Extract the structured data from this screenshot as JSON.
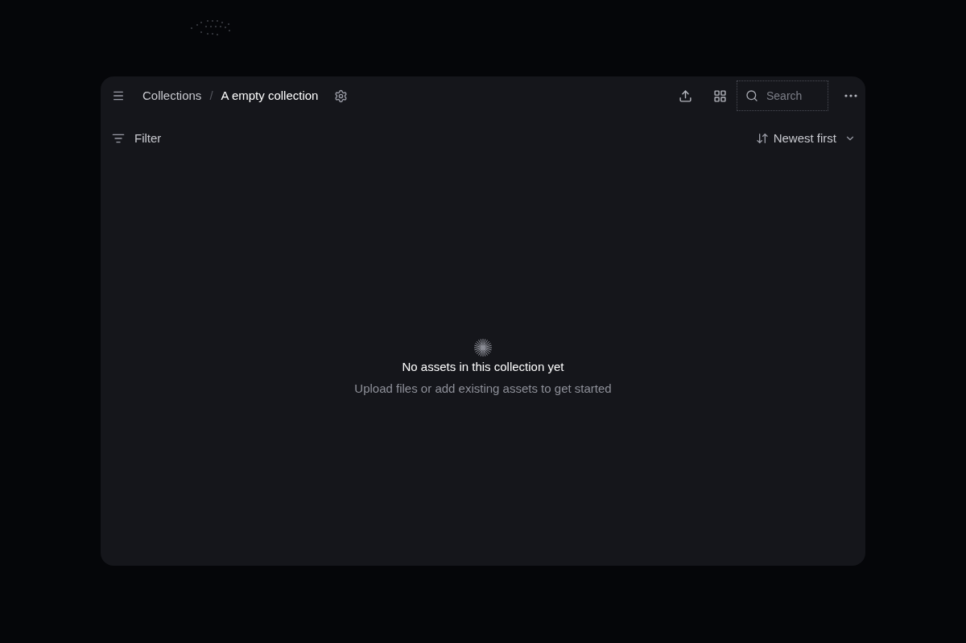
{
  "breadcrumb": [
    {
      "label": "Collections",
      "current": false
    },
    {
      "label": "A empty collection",
      "current": true
    }
  ],
  "breadcrumb_separator": "/",
  "search": {
    "placeholder": "Search"
  },
  "filter": {
    "label": "Filter"
  },
  "sort": {
    "label": "Newest first"
  },
  "empty_state": {
    "title": "No assets in this collection yet",
    "subtitle": "Upload files or add existing assets to get started"
  }
}
